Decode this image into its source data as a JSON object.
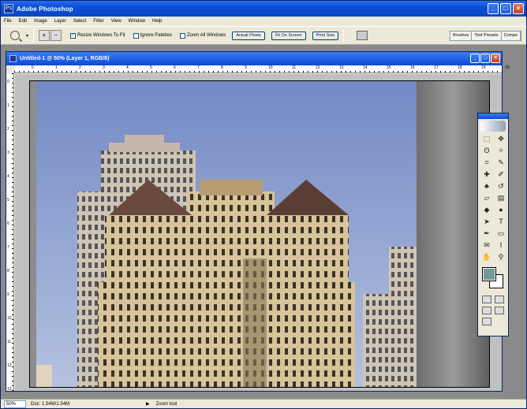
{
  "app": {
    "title": "Adobe Photoshop",
    "icon_text": "Ps"
  },
  "window_controls": {
    "minimize": "_",
    "maximize": "□",
    "close": "×"
  },
  "menu": [
    "File",
    "Edit",
    "Image",
    "Layer",
    "Select",
    "Filter",
    "View",
    "Window",
    "Help"
  ],
  "options": {
    "zoom_in": "+",
    "zoom_out": "−",
    "resize_windows": "Resize Windows To Fit",
    "ignore_palettes": "Ignore Palettes",
    "zoom_all_windows": "Zoom All Windows",
    "actual_pixels": "Actual Pixels",
    "fit_on_screen": "Fit On Screen",
    "print_size": "Print Size",
    "resize_checked": true
  },
  "palette_well": [
    "Brushes",
    "Tool Presets",
    "Comps"
  ],
  "document": {
    "title": "Untitled-1 @ 50% (Layer 1, RGB/8)",
    "ruler_numbers": [
      "0",
      "1",
      "2",
      "3",
      "4",
      "5",
      "6",
      "7",
      "8",
      "9",
      "10",
      "11",
      "12",
      "13",
      "14",
      "15",
      "16",
      "17",
      "18",
      "19",
      "20"
    ]
  },
  "status": {
    "zoom": "50%",
    "doc_info": "Doc: 1.54M/1.54M",
    "message": "Zoom tool"
  },
  "colors": {
    "foreground": "#709a9c",
    "background": "#ffffff",
    "titlebar": "#0a4fd8"
  },
  "tools": [
    "marquee-icon",
    "move-icon",
    "lasso-icon",
    "magic-wand-icon",
    "crop-icon",
    "slice-icon",
    "healing-icon",
    "brush-icon",
    "stamp-icon",
    "history-brush-icon",
    "eraser-icon",
    "gradient-icon",
    "blur-icon",
    "dodge-icon",
    "path-select-icon",
    "type-icon",
    "pen-icon",
    "shape-icon",
    "notes-icon",
    "eyedropper-icon",
    "hand-icon",
    "zoom-icon"
  ]
}
